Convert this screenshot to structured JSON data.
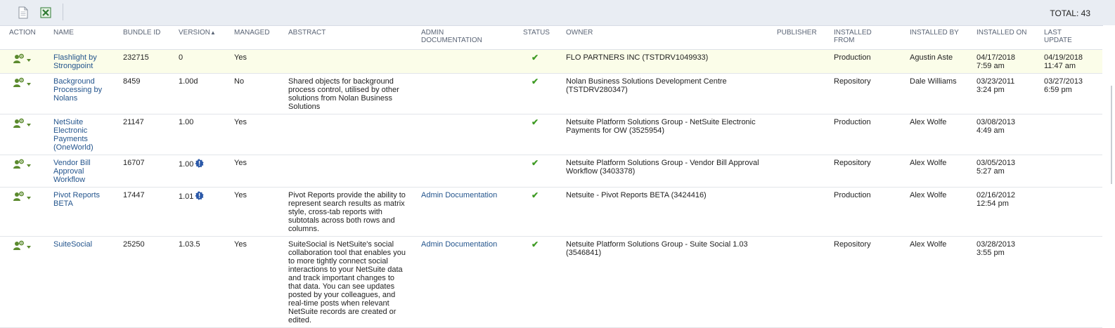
{
  "toolbar": {
    "new_icon": "new-document-icon",
    "export_icon": "excel-export-icon",
    "total": "TOTAL: 43"
  },
  "columns": {
    "action": "ACTION",
    "name": "NAME",
    "bundle_id": "BUNDLE ID",
    "version": "VERSION",
    "version_sort": "▲",
    "managed": "MANAGED",
    "abstract": "ABSTRACT",
    "admin_doc_1": "ADMIN",
    "admin_doc_2": "DOCUMENTATION",
    "status": "STATUS",
    "owner": "OWNER",
    "publisher": "PUBLISHER",
    "installed_from_1": "INSTALLED",
    "installed_from_2": "FROM",
    "installed_by": "INSTALLED BY",
    "installed_on": "INSTALLED ON",
    "last_update_1": "LAST",
    "last_update_2": "UPDATE"
  },
  "status_colors": {
    "ok": "#3f9b24",
    "info": "#2a58a8",
    "action": "#5b8a2e",
    "link": "#24558d"
  },
  "rows": [
    {
      "name_lines": [
        "Flashlight by",
        "Strongpoint"
      ],
      "bundle_id": "232715",
      "version": "0",
      "version_info": false,
      "managed": "Yes",
      "abstract_lines": [],
      "admin_doc": "",
      "status": "✔",
      "owner_lines": [
        "FLO PARTNERS INC (TSTDRV1049933)"
      ],
      "publisher": "",
      "installed_from": "Production",
      "installed_by": "Agustin Aste",
      "installed_on": [
        "04/17/2018",
        "7:59 am"
      ],
      "last_update": [
        "04/19/2018",
        "11:47 am"
      ]
    },
    {
      "name_lines": [
        "Background",
        "Processing by",
        "Nolans"
      ],
      "bundle_id": "8459",
      "version": "1.00d",
      "version_info": false,
      "managed": "No",
      "abstract_lines": [
        "Shared objects for background",
        "process control, utilised by other",
        "solutions from Nolan Business",
        "Solutions"
      ],
      "admin_doc": "",
      "status": "✔",
      "owner_lines": [
        "Nolan Business Solutions Development Centre",
        "(TSTDRV280347)"
      ],
      "publisher": "",
      "installed_from": "Repository",
      "installed_by": "Dale Williams",
      "installed_on": [
        "03/23/2011",
        "3:24 pm"
      ],
      "last_update": [
        "03/27/2013",
        "6:59 pm"
      ]
    },
    {
      "name_lines": [
        "NetSuite",
        "Electronic",
        "Payments",
        "(OneWorld)"
      ],
      "bundle_id": "21147",
      "version": "1.00",
      "version_info": false,
      "managed": "Yes",
      "abstract_lines": [],
      "admin_doc": "",
      "status": "✔",
      "owner_lines": [
        "Netsuite Platform Solutions Group - NetSuite Electronic",
        "Payments for OW (3525954)"
      ],
      "publisher": "",
      "installed_from": "Production",
      "installed_by": "Alex Wolfe",
      "installed_on": [
        "03/08/2013",
        "4:49 am"
      ],
      "last_update": [
        "",
        ""
      ]
    },
    {
      "name_lines": [
        "Vendor Bill",
        "Approval",
        "Workflow"
      ],
      "bundle_id": "16707",
      "version": "1.00",
      "version_info": true,
      "managed": "Yes",
      "abstract_lines": [],
      "admin_doc": "",
      "status": "✔",
      "owner_lines": [
        "Netsuite Platform Solutions Group - Vendor Bill Approval",
        "Workflow (3403378)"
      ],
      "publisher": "",
      "installed_from": "Repository",
      "installed_by": "Alex Wolfe",
      "installed_on": [
        "03/05/2013",
        "5:27 am"
      ],
      "last_update": [
        "",
        ""
      ]
    },
    {
      "name_lines": [
        "Pivot Reports",
        "BETA"
      ],
      "bundle_id": "17447",
      "version": "1.01",
      "version_info": true,
      "managed": "Yes",
      "abstract_lines": [
        "Pivot Reports provide the ability to",
        "represent search results as matrix",
        "style, cross-tab reports with",
        "subtotals across both rows and",
        "columns."
      ],
      "admin_doc": "Admin Documentation",
      "status": "✔",
      "owner_lines": [
        "Netsuite - Pivot Reports BETA (3424416)"
      ],
      "publisher": "",
      "installed_from": "Production",
      "installed_by": "Alex Wolfe",
      "installed_on": [
        "02/16/2012",
        "12:54 pm"
      ],
      "last_update": [
        "",
        ""
      ]
    },
    {
      "name_lines": [
        "SuiteSocial"
      ],
      "bundle_id": "25250",
      "version": "1.03.5",
      "version_info": false,
      "managed": "Yes",
      "abstract_lines": [
        "SuiteSocial is NetSuite's social",
        "collaboration tool that enables you",
        "to more tightly connect social",
        "interactions to your NetSuite data",
        "and track important changes to",
        "that data. You can see updates",
        "posted by your colleagues, and",
        "real-time posts when relevant",
        "NetSuite records are created or",
        "edited."
      ],
      "admin_doc": "Admin Documentation",
      "status": "✔",
      "owner_lines": [
        "Netsuite Platform Solutions Group - Suite Social 1.03",
        "(3546841)"
      ],
      "publisher": "",
      "installed_from": "Repository",
      "installed_by": "Alex Wolfe",
      "installed_on": [
        "03/28/2013",
        "3:55 pm"
      ],
      "last_update": [
        "",
        ""
      ]
    }
  ]
}
